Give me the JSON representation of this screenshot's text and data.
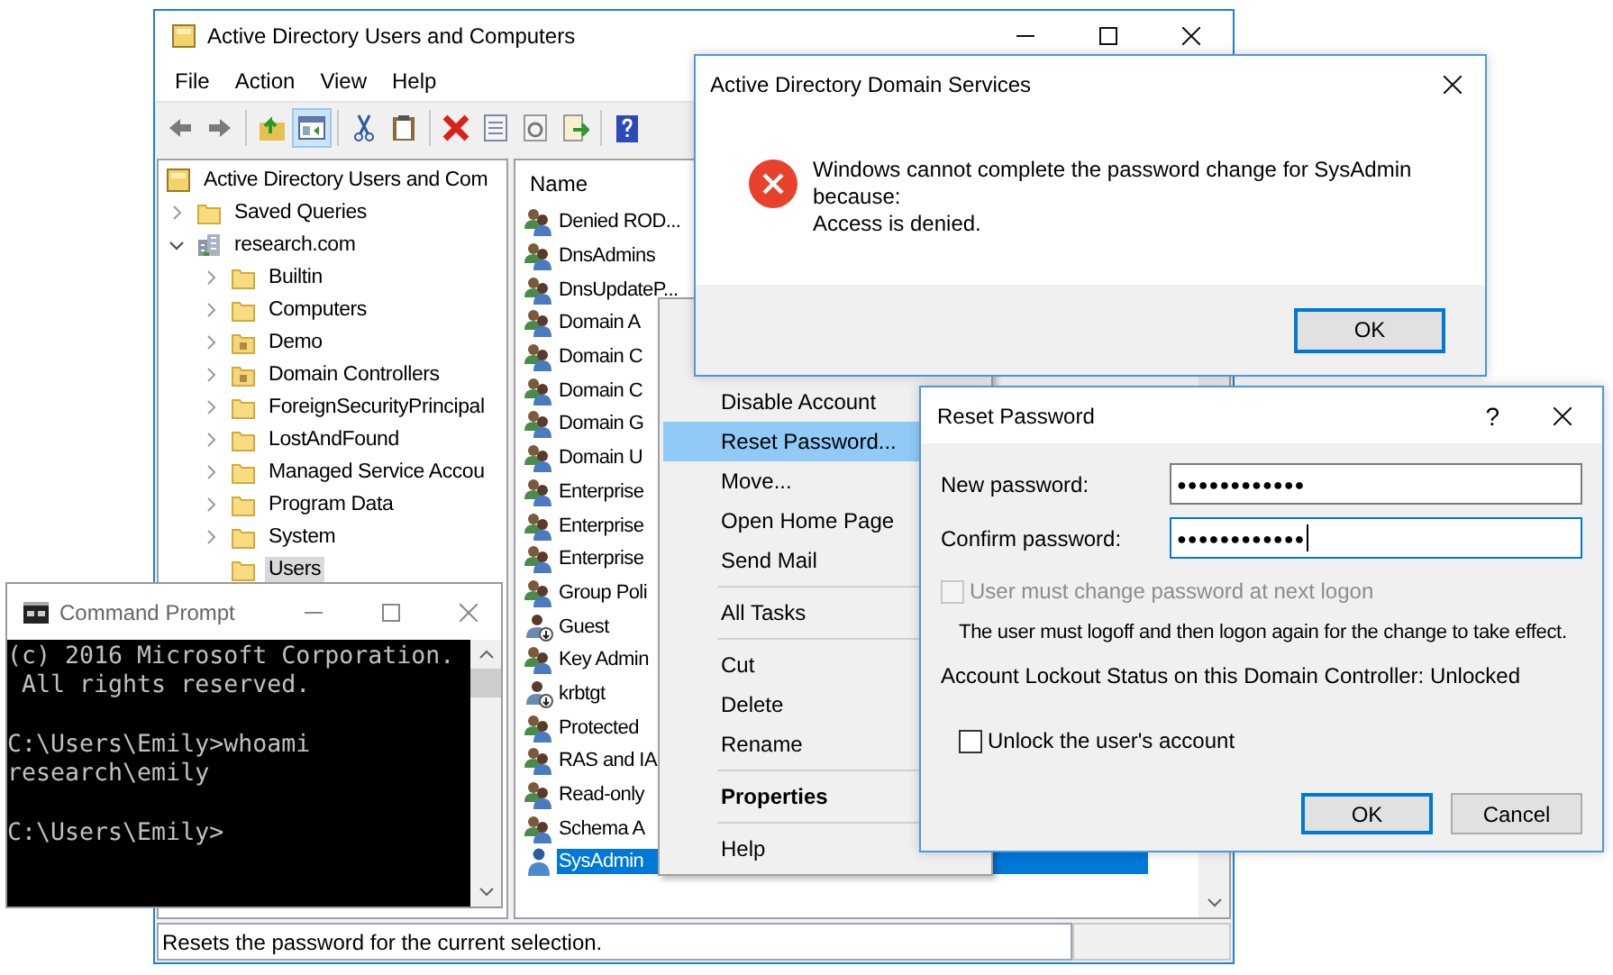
{
  "main_window": {
    "title": "Active Directory Users and Computers",
    "menu": [
      "File",
      "Action",
      "View",
      "Help"
    ],
    "toolbar": [
      {
        "kind": "back",
        "pressed": false
      },
      {
        "kind": "forward",
        "pressed": false
      },
      {
        "kind": "separator"
      },
      {
        "kind": "up",
        "pressed": false
      },
      {
        "kind": "console-tree",
        "pressed": true
      },
      {
        "kind": "separator"
      },
      {
        "kind": "cut",
        "pressed": false
      },
      {
        "kind": "paste",
        "pressed": false
      },
      {
        "kind": "separator"
      },
      {
        "kind": "delete",
        "pressed": false
      },
      {
        "kind": "properties",
        "pressed": false
      },
      {
        "kind": "refresh",
        "pressed": false
      },
      {
        "kind": "export",
        "pressed": false
      },
      {
        "kind": "separator"
      },
      {
        "kind": "help",
        "pressed": false
      }
    ],
    "tree": [
      {
        "label": "Active Directory Users and Com",
        "kind": "root",
        "selected": false,
        "children": [
          {
            "label": "Saved Queries",
            "kind": "folder",
            "expandable": true,
            "expanded": false,
            "selected": false
          },
          {
            "label": "research.com",
            "kind": "domain",
            "expandable": true,
            "expanded": true,
            "selected": false,
            "children": [
              {
                "label": "Builtin",
                "kind": "folder",
                "expandable": true,
                "expanded": false,
                "selected": false
              },
              {
                "label": "Computers",
                "kind": "folder",
                "expandable": true,
                "expanded": false,
                "selected": false
              },
              {
                "label": "Demo",
                "kind": "ou",
                "expandable": true,
                "expanded": false,
                "selected": false
              },
              {
                "label": "Domain Controllers",
                "kind": "ou",
                "expandable": true,
                "expanded": false,
                "selected": false
              },
              {
                "label": "ForeignSecurityPrincipal",
                "kind": "folder",
                "expandable": true,
                "expanded": false,
                "selected": false
              },
              {
                "label": "LostAndFound",
                "kind": "folder",
                "expandable": true,
                "expanded": false,
                "selected": false
              },
              {
                "label": "Managed Service Accou",
                "kind": "folder",
                "expandable": true,
                "expanded": false,
                "selected": false
              },
              {
                "label": "Program Data",
                "kind": "folder",
                "expandable": true,
                "expanded": false,
                "selected": false
              },
              {
                "label": "System",
                "kind": "folder",
                "expandable": true,
                "expanded": false,
                "selected": false
              },
              {
                "label": "Users",
                "kind": "folder",
                "selected": true
              }
            ]
          }
        ]
      }
    ],
    "list": {
      "columns": [
        "Name"
      ],
      "rows": [
        {
          "name": "Denied ROD...",
          "kind": "group",
          "selected": false
        },
        {
          "name": "DnsAdmins",
          "kind": "group",
          "selected": false
        },
        {
          "name": "DnsUpdateP...",
          "kind": "group",
          "selected": false
        },
        {
          "name": "Domain A",
          "kind": "group",
          "selected": false
        },
        {
          "name": "Domain C",
          "kind": "group",
          "selected": false
        },
        {
          "name": "Domain C",
          "kind": "group",
          "selected": false
        },
        {
          "name": "Domain G",
          "kind": "group",
          "selected": false
        },
        {
          "name": "Domain U",
          "kind": "group",
          "selected": false
        },
        {
          "name": "Enterprise",
          "kind": "group",
          "selected": false
        },
        {
          "name": "Enterprise",
          "kind": "group",
          "selected": false
        },
        {
          "name": "Enterprise",
          "kind": "group",
          "selected": false
        },
        {
          "name": "Group Poli",
          "kind": "group",
          "selected": false
        },
        {
          "name": "Guest",
          "kind": "disabled-user",
          "selected": false
        },
        {
          "name": "Key Admin",
          "kind": "group",
          "selected": false
        },
        {
          "name": "krbtgt",
          "kind": "disabled-user",
          "selected": false
        },
        {
          "name": "Protected",
          "kind": "group",
          "selected": false
        },
        {
          "name": "RAS and IA",
          "kind": "group",
          "selected": false
        },
        {
          "name": "Read-only",
          "kind": "group",
          "selected": false
        },
        {
          "name": "Schema A",
          "kind": "group",
          "selected": false
        },
        {
          "name": "SysAdmin",
          "kind": "user",
          "selected": true
        }
      ]
    },
    "status_bar": "Resets the password for the current selection."
  },
  "context_menu": {
    "items": [
      {
        "kind": "item",
        "label": "Disable Account",
        "selected": false,
        "bold": false
      },
      {
        "kind": "item",
        "label": "Reset Password...",
        "selected": true,
        "bold": false
      },
      {
        "kind": "item",
        "label": "Move...",
        "selected": false,
        "bold": false
      },
      {
        "kind": "item",
        "label": "Open Home Page",
        "selected": false,
        "bold": false
      },
      {
        "kind": "item",
        "label": "Send Mail",
        "selected": false,
        "bold": false
      },
      {
        "kind": "separator"
      },
      {
        "kind": "item",
        "label": "All Tasks",
        "selected": false,
        "bold": false
      },
      {
        "kind": "separator"
      },
      {
        "kind": "item",
        "label": "Cut",
        "selected": false,
        "bold": false
      },
      {
        "kind": "item",
        "label": "Delete",
        "selected": false,
        "bold": false
      },
      {
        "kind": "item",
        "label": "Rename",
        "selected": false,
        "bold": false
      },
      {
        "kind": "separator"
      },
      {
        "kind": "item",
        "label": "Properties",
        "selected": false,
        "bold": true
      },
      {
        "kind": "separator"
      },
      {
        "kind": "item",
        "label": "Help",
        "selected": false,
        "bold": false
      }
    ]
  },
  "error_dialog": {
    "title": "Active Directory Domain Services",
    "message": [
      "Windows cannot complete the password change for SysAdmin because:",
      "Access is denied."
    ],
    "button": {
      "label": "OK",
      "default": true
    }
  },
  "reset_dialog": {
    "title": "Reset Password",
    "help": "?",
    "fields": [
      {
        "label": "New password:",
        "value": "●●●●●●●●●●●●",
        "focused": false
      },
      {
        "label": "Confirm password:",
        "value": "●●●●●●●●●●●●",
        "focused": true
      }
    ],
    "must_change": {
      "label": "User must change password at next logon",
      "checked": false,
      "disabled": true
    },
    "note": "The user must logoff and then logon again for the change to take effect.",
    "lockout_status": "Account Lockout Status on this Domain Controller: Unlocked",
    "unlock": {
      "label": "Unlock the user's account",
      "checked": false,
      "disabled": false
    },
    "buttons": [
      {
        "label": "OK",
        "default": true
      },
      {
        "label": "Cancel",
        "default": false
      }
    ]
  },
  "command_prompt": {
    "title": "Command Prompt",
    "blocks": [
      [
        "(c) 2016 Microsoft Corporation.",
        " All rights reserved."
      ],
      [
        "C:\\Users\\Emily>whoami",
        "research\\emily"
      ],
      [
        "C:\\Users\\Emily>"
      ]
    ]
  }
}
